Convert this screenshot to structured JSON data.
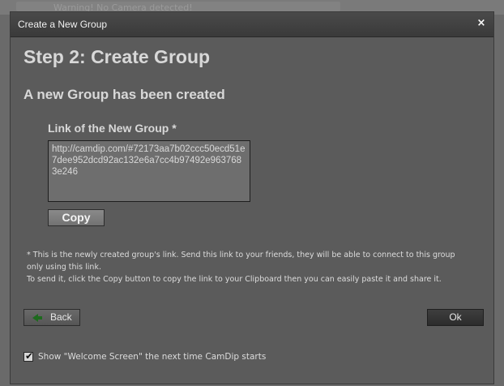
{
  "background": {
    "banner_text": "Warning! No Camera detected!"
  },
  "dialog": {
    "title": "Create a New Group",
    "close_symbol": "×",
    "step_title": "Step 2: Create Group",
    "subtitle": "A new Group has been created",
    "link_label": "Link of the New Group *",
    "link_value": "http://camdip.com/#72173aa7b02ccc50ecd51e7dee952dcd92ac132e6a7cc4b97492e9637683e246",
    "copy_label": "Copy",
    "note_lines": [
      "* This is the newly created group's link. Send this link to your friends, they will be able to connect to this group",
      "only using this link.",
      "To send it, click the Copy button to copy the link to your Clipboard then you can easily paste it and share it."
    ],
    "back_label": "Back",
    "ok_label": "Ok",
    "welcome_checkbox": {
      "checked": true,
      "label": "Show \"Welcome Screen\" the next time CamDip starts"
    }
  },
  "colors": {
    "dialog_bg": "#5b5b5b",
    "titlebar_bg": "#3a3a3a",
    "text_light": "#d8d8d8",
    "back_arrow": "#1e6a1e"
  },
  "icons": {
    "close": "close-icon",
    "back_arrow": "arrow-left-icon",
    "checkmark": "checkmark-icon"
  }
}
